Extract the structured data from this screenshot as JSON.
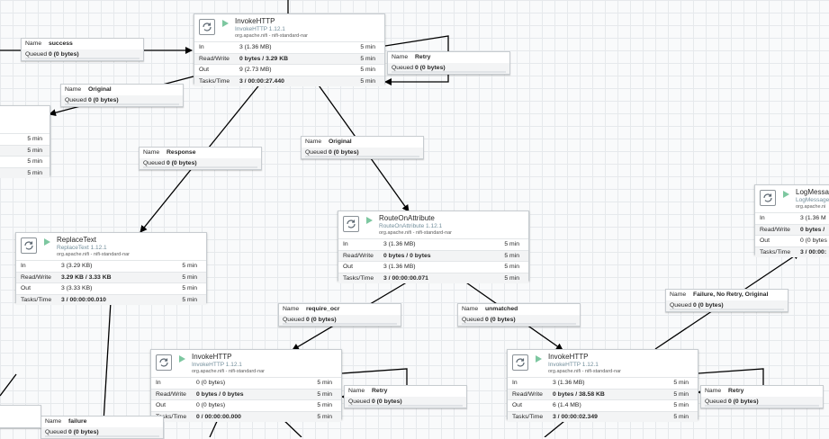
{
  "canvas": {
    "grid_color": "#e6e9ec",
    "background": "#f9fafb",
    "line_color": "#000000",
    "run_color": "#7dc7a0"
  },
  "labels": {
    "name": "Name",
    "queued": "Queued",
    "in": "In",
    "read_write": "Read/Write",
    "out": "Out",
    "tasks_time": "Tasks/Time"
  },
  "processors": {
    "invoke_top": {
      "name": "InvokeHTTP",
      "type": "InvokeHTTP 1.12.1",
      "bundle": "org.apache.nifi - nifi-standard-nar",
      "in_val": "3 (1.36 MB)",
      "in_time": "5 min",
      "rw_val": "0 bytes / 3.29 KB",
      "rw_time": "5 min",
      "out_val": "9 (2.73 MB)",
      "out_time": "5 min",
      "tasks_val": "3 / 00:00:27.440",
      "tasks_time": "5 min"
    },
    "replace": {
      "name": "ReplaceText",
      "type": "ReplaceText 1.12.1",
      "bundle": "org.apache.nifi - nifi-standard-nar",
      "in_val": "3 (3.29 KB)",
      "in_time": "5 min",
      "rw_val": "3.29 KB / 3.33 KB",
      "rw_time": "5 min",
      "out_val": "3 (3.33 KB)",
      "out_time": "5 min",
      "tasks_val": "3 / 00:00:00.010",
      "tasks_time": "5 min"
    },
    "route": {
      "name": "RouteOnAttribute",
      "type": "RouteOnAttribute 1.12.1",
      "bundle": "org.apache.nifi - nifi-standard-nar",
      "in_val": "3 (1.36 MB)",
      "in_time": "5 min",
      "rw_val": "0 bytes / 0 bytes",
      "rw_time": "5 min",
      "out_val": "3 (1.36 MB)",
      "out_time": "5 min",
      "tasks_val": "3 / 00:00:00.071",
      "tasks_time": "5 min"
    },
    "invoke_left": {
      "name": "InvokeHTTP",
      "type": "InvokeHTTP 1.12.1",
      "bundle": "org.apache.nifi - nifi-standard-nar",
      "in_val": "0 (0 bytes)",
      "in_time": "5 min",
      "rw_val": "0 bytes / 0 bytes",
      "rw_time": "5 min",
      "out_val": "0 (0 bytes)",
      "out_time": "5 min",
      "tasks_val": "0 / 00:00:00.000",
      "tasks_time": "5 min"
    },
    "invoke_right": {
      "name": "InvokeHTTP",
      "type": "InvokeHTTP 1.12.1",
      "bundle": "org.apache.nifi - nifi-standard-nar",
      "in_val": "3 (1.36 MB)",
      "in_time": "5 min",
      "rw_val": "0 bytes / 38.58 KB",
      "rw_time": "5 min",
      "out_val": "6 (1.4 MB)",
      "out_time": "5 min",
      "tasks_val": "3 / 00:00:02.349",
      "tasks_time": "5 min"
    },
    "logmsg": {
      "name": "LogMessage",
      "type": "LogMessage",
      "bundle": "org.apache.ni",
      "in_val": "3 (1.36 M",
      "rw_val": "0 bytes /",
      "out_val": "0 (0 bytes",
      "tasks_val": "3 / 00:00:"
    },
    "left_partial": {
      "in_time": "5 min",
      "rw_time": "5 min",
      "out_time": "5 min",
      "tasks_time": "5 min"
    }
  },
  "connections": {
    "success": {
      "name": "success",
      "queued": "0 (0 bytes)"
    },
    "retry_top": {
      "name": "Retry",
      "queued": "0 (0 bytes)"
    },
    "original_left": {
      "name": "Original",
      "queued": "0 (0 bytes)"
    },
    "response": {
      "name": "Response",
      "queued": "0 (0 bytes)"
    },
    "original_mid": {
      "name": "Original",
      "queued": "0 (0 bytes)"
    },
    "require_ocr": {
      "name": "require_ocr",
      "queued": "0 (0 bytes)"
    },
    "unmatched": {
      "name": "unmatched",
      "queued": "0 (0 bytes)"
    },
    "failure_log": {
      "name": "Failure, No Retry, Original",
      "queued": "0 (0 bytes)"
    },
    "retry_left": {
      "name": "Retry",
      "queued": "0 (0 bytes)"
    },
    "retry_right": {
      "name": "Retry",
      "queued": "0 (0 bytes)"
    },
    "failure": {
      "name": "failure",
      "queued": "0 (0 bytes)"
    }
  }
}
